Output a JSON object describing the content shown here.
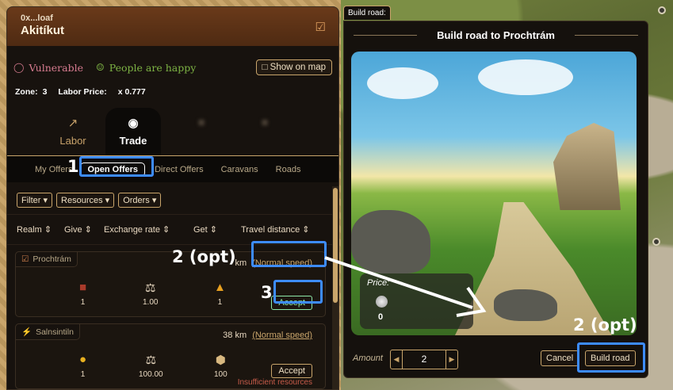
{
  "realm": {
    "owner": "0x...loaf",
    "name": "Akitíkut",
    "status_vulnerable": "Vulnerable",
    "status_happy": "People are happy",
    "show_on_map": "Show on map",
    "zone_label": "Zone:",
    "zone_value": "3",
    "labor_price_label": "Labor Price:",
    "labor_price_value": "x 0.777"
  },
  "main_tabs": [
    {
      "label": "Labor"
    },
    {
      "label": "Trade"
    }
  ],
  "sub_tabs": [
    {
      "label": "My Offers"
    },
    {
      "label": "Open Offers"
    },
    {
      "label": "Direct Offers"
    },
    {
      "label": "Caravans"
    },
    {
      "label": "Roads"
    }
  ],
  "filters": [
    "Filter",
    "Resources",
    "Orders"
  ],
  "columns": [
    "Realm",
    "Give",
    "Exchange rate",
    "Get",
    "Travel distance"
  ],
  "offers": [
    {
      "realm": "Prochtrám",
      "distance": "km",
      "speed": "(Normal speed)",
      "give_amount": "1",
      "rate": "1.00",
      "get_amount": "1",
      "accept": "Accept"
    },
    {
      "realm": "Salnsintiln",
      "distance": "38 km",
      "speed": "(Normal speed)",
      "give_amount": "1",
      "rate": "100.00",
      "get_amount": "100",
      "accept": "Accept",
      "warning": "Insufficient resources"
    }
  ],
  "dialog": {
    "tab": "Build road:",
    "title": "Build road to Prochtrám",
    "price_label": "Price:",
    "price_value": "0",
    "amount_label": "Amount",
    "amount_value": "2",
    "cancel": "Cancel",
    "build": "Build road"
  },
  "annotations": {
    "n1": "1",
    "n2a": "2 (opt)",
    "n3": "3",
    "n2b": "2 (opt)"
  },
  "icons": {
    "vulnerable": "shield-icon",
    "happy": "people-icon",
    "labor": "hammer-icon",
    "trade": "coins-icon",
    "crest": "crest-icon"
  },
  "colors": {
    "header": "#6a3a1a",
    "accent": "#c9a56b",
    "highlight": "#3d8cff",
    "happy": "#7db344",
    "vulnerable": "#d67b8f",
    "warning": "#c85c4a"
  }
}
